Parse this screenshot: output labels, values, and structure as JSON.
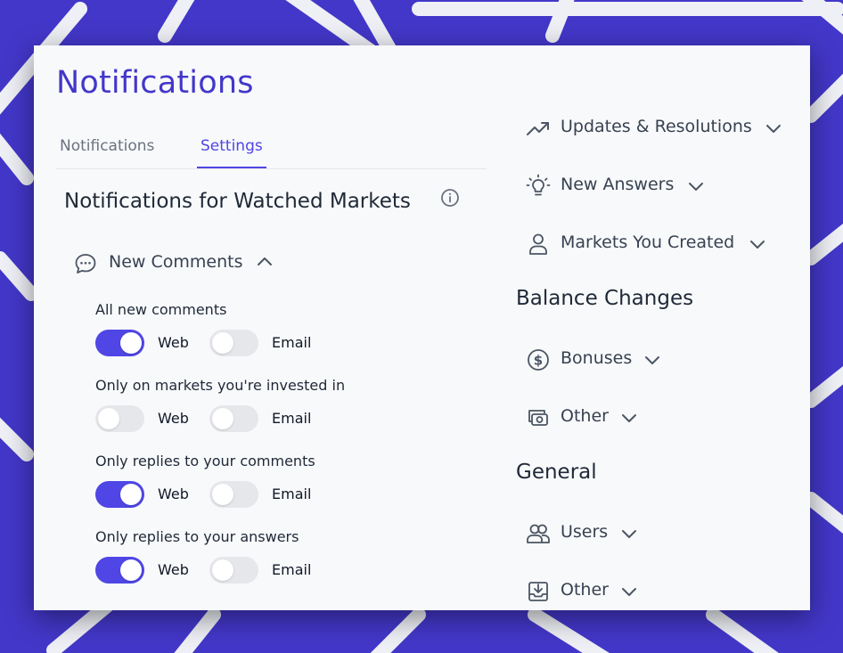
{
  "page": {
    "title": "Notifications"
  },
  "tabs": [
    {
      "label": "Notifications",
      "active": false
    },
    {
      "label": "Settings",
      "active": true
    }
  ],
  "watched": {
    "title": "Notifications for Watched Markets",
    "new_comments": {
      "label": "New Comments",
      "expanded": true,
      "options": [
        {
          "label": "All new comments",
          "web_label": "Web",
          "web": true,
          "email_label": "Email",
          "email": false
        },
        {
          "label": "Only on markets you're invested in",
          "web_label": "Web",
          "web": false,
          "email_label": "Email",
          "email": false
        },
        {
          "label": "Only replies to your comments",
          "web_label": "Web",
          "web": true,
          "email_label": "Email",
          "email": false
        },
        {
          "label": "Only replies to your answers",
          "web_label": "Web",
          "web": true,
          "email_label": "Email",
          "email": false
        }
      ]
    }
  },
  "right": {
    "updates": {
      "label": "Updates & Resolutions",
      "icon": "trending-up-icon"
    },
    "new_answers": {
      "label": "New Answers",
      "icon": "lightbulb-icon"
    },
    "markets_created": {
      "label": "Markets You Created",
      "icon": "user-icon"
    },
    "balance_changes": {
      "title": "Balance Changes",
      "bonuses": {
        "label": "Bonuses",
        "icon": "dollar-circle-icon"
      },
      "other": {
        "label": "Other",
        "icon": "cash-icon"
      }
    },
    "general": {
      "title": "General",
      "users": {
        "label": "Users",
        "icon": "users-icon"
      },
      "other": {
        "label": "Other",
        "icon": "inbox-download-icon"
      }
    }
  },
  "colors": {
    "accent": "#4f46e5",
    "title": "#4337c9",
    "background": "#4337c9",
    "toggle_off": "#e5e7eb"
  }
}
